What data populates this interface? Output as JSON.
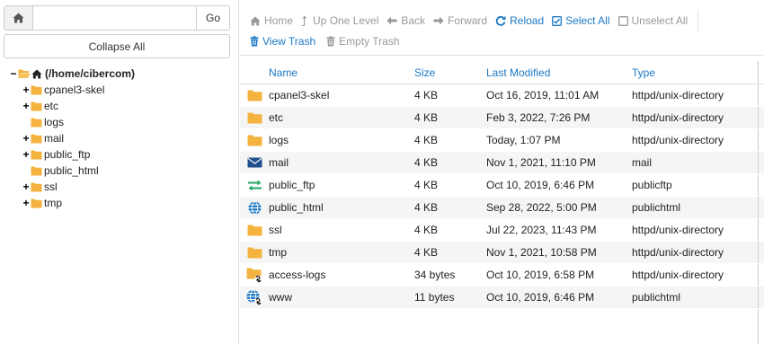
{
  "left_pane": {
    "path_value": "",
    "go_label": "Go",
    "collapse_label": "Collapse All",
    "root_label": "(/home/cibercom)",
    "tree": [
      {
        "label": "cpanel3-skel",
        "expandable": true
      },
      {
        "label": "etc",
        "expandable": true
      },
      {
        "label": "logs",
        "expandable": false
      },
      {
        "label": "mail",
        "expandable": true
      },
      {
        "label": "public_ftp",
        "expandable": true
      },
      {
        "label": "public_html",
        "expandable": false
      },
      {
        "label": "ssl",
        "expandable": true
      },
      {
        "label": "tmp",
        "expandable": true
      }
    ]
  },
  "toolbar": {
    "home": "Home",
    "up_one_level": "Up One Level",
    "back": "Back",
    "forward": "Forward",
    "reload": "Reload",
    "select_all": "Select All",
    "unselect_all": "Unselect All",
    "view_trash": "View Trash",
    "empty_trash": "Empty Trash"
  },
  "table": {
    "headers": {
      "name": "Name",
      "size": "Size",
      "modified": "Last Modified",
      "type": "Type"
    },
    "rows": [
      {
        "icon": "folder-icon",
        "name": "cpanel3-skel",
        "size": "4 KB",
        "modified": "Oct 16, 2019, 11:01 AM",
        "type": "httpd/unix-directory"
      },
      {
        "icon": "folder-icon",
        "name": "etc",
        "size": "4 KB",
        "modified": "Feb 3, 2022, 7:26 PM",
        "type": "httpd/unix-directory"
      },
      {
        "icon": "folder-icon",
        "name": "logs",
        "size": "4 KB",
        "modified": "Today, 1:07 PM",
        "type": "httpd/unix-directory"
      },
      {
        "icon": "mail-icon",
        "name": "mail",
        "size": "4 KB",
        "modified": "Nov 1, 2021, 11:10 PM",
        "type": "mail"
      },
      {
        "icon": "ftp-icon",
        "name": "public_ftp",
        "size": "4 KB",
        "modified": "Oct 10, 2019, 6:46 PM",
        "type": "publicftp"
      },
      {
        "icon": "globe-icon",
        "name": "public_html",
        "size": "4 KB",
        "modified": "Sep 28, 2022, 5:00 PM",
        "type": "publichtml"
      },
      {
        "icon": "folder-icon",
        "name": "ssl",
        "size": "4 KB",
        "modified": "Jul 22, 2023, 11:43 PM",
        "type": "httpd/unix-directory"
      },
      {
        "icon": "folder-icon",
        "name": "tmp",
        "size": "4 KB",
        "modified": "Nov 1, 2021, 10:58 PM",
        "type": "httpd/unix-directory"
      },
      {
        "icon": "folder-link-icon",
        "name": "access-logs",
        "size": "34 bytes",
        "modified": "Oct 10, 2019, 6:58 PM",
        "type": "httpd/unix-directory"
      },
      {
        "icon": "globe-link-icon",
        "name": "www",
        "size": "11 bytes",
        "modified": "Oct 10, 2019, 6:46 PM",
        "type": "publichtml"
      }
    ]
  },
  "colors": {
    "accent": "#1c78c4",
    "folder": "#f4b23e",
    "disabled": "#999999",
    "ftp": "#27a567",
    "row_alt": "#f5f5f5"
  }
}
